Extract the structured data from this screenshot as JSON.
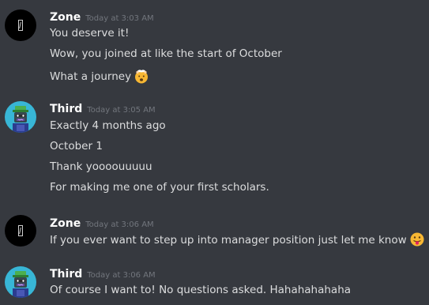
{
  "messages": [
    {
      "username": "Zone",
      "timestamp": "Today at 3:03 AM",
      "avatar_icon": "zone-logo-icon",
      "lines": [
        {
          "text": "You deserve it!"
        },
        {
          "text": "Wow, you joined at like the start of October"
        },
        {
          "text": "What a journey",
          "emoji": "mind-blown-emoji"
        }
      ]
    },
    {
      "username": "Third",
      "timestamp": "Today at 3:05 AM",
      "avatar_icon": "green-robot-avatar-icon",
      "lines": [
        {
          "text": "Exactly 4 months ago"
        },
        {
          "text": "October 1"
        },
        {
          "text": "Thank yoooouuuuu"
        },
        {
          "text": "For making me one of your first scholars."
        }
      ]
    },
    {
      "username": "Zone",
      "timestamp": "Today at 3:06 AM",
      "avatar_icon": "zone-logo-icon",
      "lines": [
        {
          "text": "If you ever want to step up into manager position just let me know",
          "emoji": "tongue-out-emoji"
        }
      ]
    },
    {
      "username": "Third",
      "timestamp": "Today at 3:06 AM",
      "avatar_icon": "green-robot-avatar-icon",
      "lines": [
        {
          "text": "Of course I want to! No questions asked. Hahahahahaha"
        }
      ]
    }
  ],
  "colors": {
    "background": "#36393f",
    "username": "#ffffff",
    "timestamp": "#72767d",
    "message_text": "#dcddde",
    "third_avatar_bg": "#38b6d6",
    "emoji_yellow": "#f7b733"
  }
}
